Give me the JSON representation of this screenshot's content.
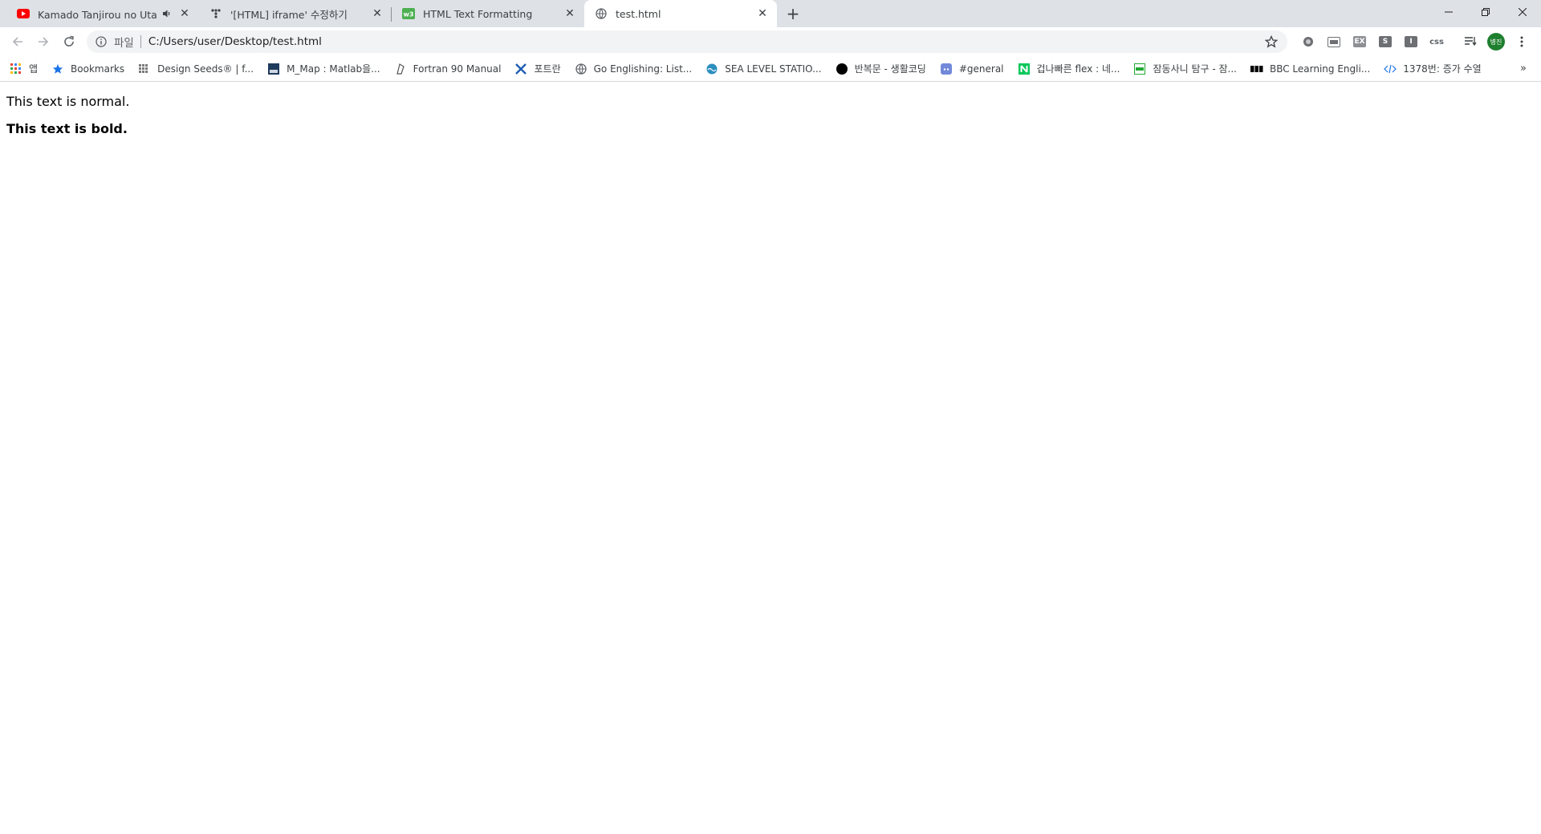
{
  "tabs": [
    {
      "title": "Kamado Tanjirou no Uta (影",
      "audio": true,
      "active": false
    },
    {
      "title": "'[HTML] iframe' 수정하기",
      "active": false
    },
    {
      "title": "HTML Text Formatting",
      "active": false
    },
    {
      "title": "test.html",
      "active": true
    }
  ],
  "omnibox": {
    "scheme": "파일",
    "url": "C:/Users/user/Desktop/test.html"
  },
  "extensions": [
    {
      "icon": "circle-extension-icon"
    },
    {
      "icon": "window-extension-icon"
    },
    {
      "icon": "box-extension-icon",
      "label": "EX"
    },
    {
      "icon": "s-extension-icon",
      "label": "S"
    },
    {
      "icon": "i-extension-icon",
      "label": "I"
    },
    {
      "icon": "css-extension-icon",
      "label": "css"
    }
  ],
  "profile": {
    "label": "병진",
    "color": "#1e7f2e"
  },
  "bookmarks": [
    {
      "label": "앱",
      "icon": "apps-grid-icon"
    },
    {
      "label": "Bookmarks",
      "icon": "star-icon"
    },
    {
      "label": "Design Seeds® | f...",
      "icon": "design-seeds-icon"
    },
    {
      "label": "M_Map : Matlab을...",
      "icon": "mmap-icon"
    },
    {
      "label": "Fortran 90 Manual",
      "icon": "fortran-icon"
    },
    {
      "label": "포트란",
      "icon": "cross-tools-icon"
    },
    {
      "label": "Go Englishing: List...",
      "icon": "globe-icon"
    },
    {
      "label": "SEA LEVEL STATIO...",
      "icon": "sea-level-icon"
    },
    {
      "label": "반복문 - 생활코딩",
      "icon": "black-circle-icon"
    },
    {
      "label": "#general",
      "icon": "discord-icon"
    },
    {
      "label": "겁나빠른 flex : 네...",
      "icon": "naver-icon"
    },
    {
      "label": "잠동사니 탐구 - 잠...",
      "icon": "green-box-icon"
    },
    {
      "label": "BBC Learning Engli...",
      "icon": "bbc-icon"
    },
    {
      "label": "1378번: 증가 수열",
      "icon": "code-icon"
    }
  ],
  "page": {
    "normal_text": "This text is normal.",
    "bold_text": "This text is bold."
  }
}
